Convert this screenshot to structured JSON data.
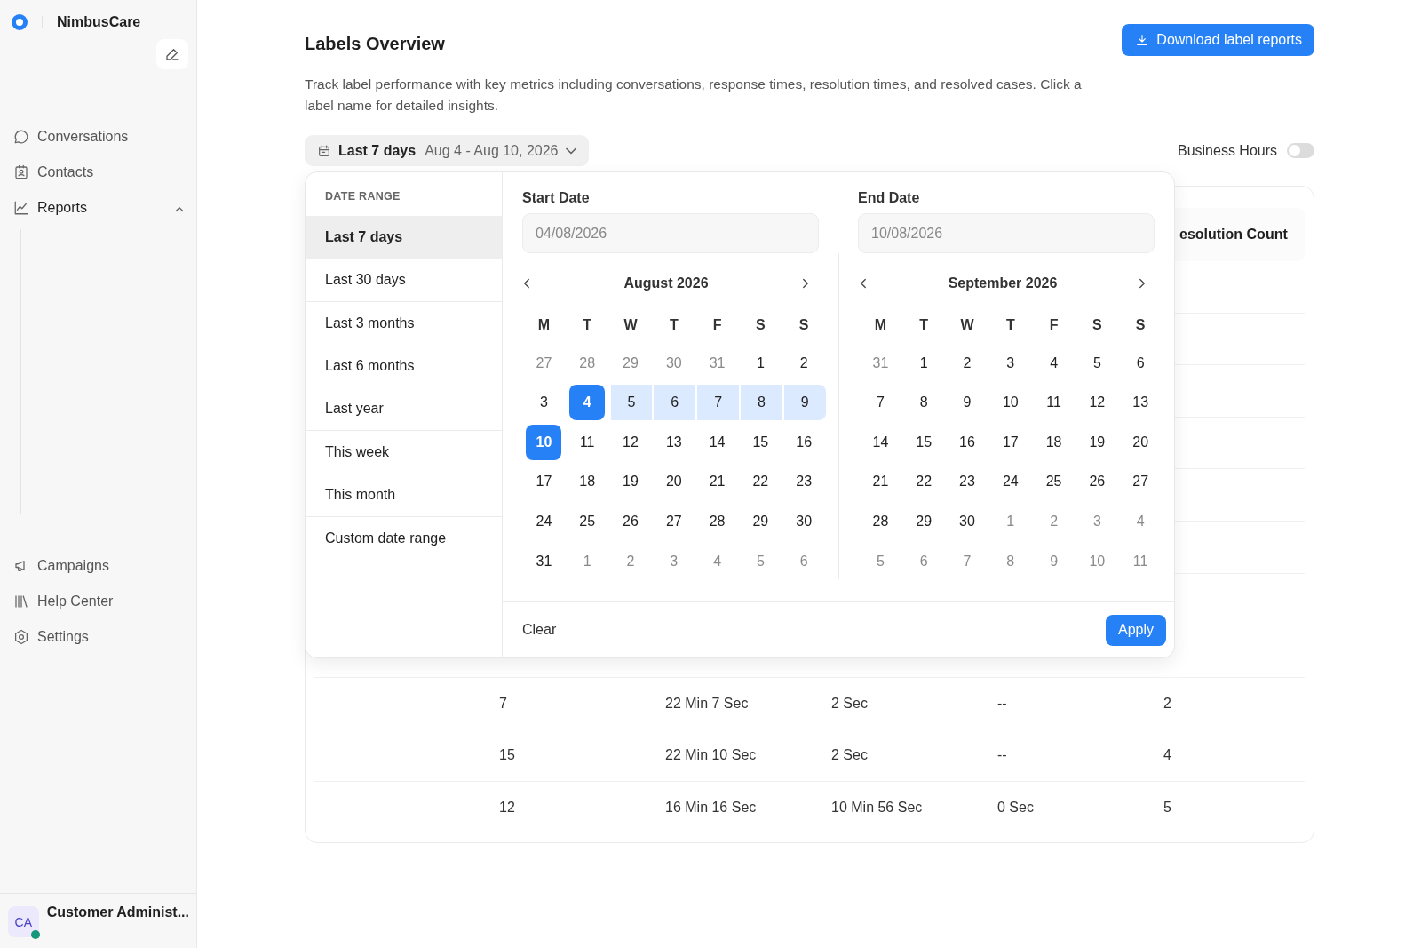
{
  "sidebar": {
    "brand": "NimbusCare",
    "nav": [
      {
        "label": "Conversations"
      },
      {
        "label": "Contacts"
      },
      {
        "label": "Reports",
        "expanded": true
      }
    ],
    "nav_bottom": [
      {
        "label": "Campaigns"
      },
      {
        "label": "Help Center"
      },
      {
        "label": "Settings"
      }
    ],
    "user": {
      "initials": "CA",
      "name": "Customer Administ...",
      "online": true
    }
  },
  "main": {
    "title": "Labels Overview",
    "download_button": "Download label reports",
    "description": "Track label performance with key metrics including conversations, response times, resolution times, and resolved cases. Click a label name for detailed insights.",
    "date_filter": {
      "preset": "Last 7 days",
      "range": "Aug 4 - Aug 10, 2026"
    },
    "business_hours": {
      "label": "Business Hours",
      "on": false
    },
    "table": {
      "visible_header": "esolution Count",
      "rows": [
        [
          "7",
          "22 Min 7 Sec",
          "2 Sec",
          "--",
          "2"
        ],
        [
          "15",
          "22 Min 10 Sec",
          "2 Sec",
          "--",
          "4"
        ],
        [
          "12",
          "16 Min 16 Sec",
          "10 Min 56 Sec",
          "0 Sec",
          "5"
        ]
      ]
    },
    "date_picker": {
      "heading": "DATE RANGE",
      "preset_groups": [
        [
          {
            "label": "Last 7 days",
            "selected": true
          },
          {
            "label": "Last 30 days",
            "selected": false
          }
        ],
        [
          {
            "label": "Last 3 months",
            "selected": false
          },
          {
            "label": "Last 6 months",
            "selected": false
          },
          {
            "label": "Last year",
            "selected": false
          }
        ],
        [
          {
            "label": "This week",
            "selected": false
          },
          {
            "label": "This month",
            "selected": false
          }
        ],
        [
          {
            "label": "Custom date range",
            "selected": false
          }
        ]
      ],
      "fields": [
        {
          "label": "Start Date",
          "placeholder": "04/08/2026"
        },
        {
          "label": "End Date",
          "placeholder": "10/08/2026"
        }
      ],
      "months": [
        {
          "title": "August 2026",
          "weekdays": [
            "M",
            "T",
            "W",
            "T",
            "F",
            "S",
            "S"
          ],
          "weeks": [
            [
              {
                "day": "27",
                "muted": true,
                "selected": false,
                "in_range": false
              },
              {
                "day": "28",
                "muted": true,
                "selected": false,
                "in_range": false
              },
              {
                "day": "29",
                "muted": true,
                "selected": false,
                "in_range": false
              },
              {
                "day": "30",
                "muted": true,
                "selected": false,
                "in_range": false
              },
              {
                "day": "31",
                "muted": true,
                "selected": false,
                "in_range": false
              },
              {
                "day": "1",
                "muted": false,
                "selected": false,
                "in_range": false
              },
              {
                "day": "2",
                "muted": false,
                "selected": false,
                "in_range": false
              }
            ],
            [
              {
                "day": "3",
                "muted": false,
                "selected": false,
                "in_range": false
              },
              {
                "day": "4",
                "muted": false,
                "selected": true,
                "in_range": false
              },
              {
                "day": "5",
                "muted": false,
                "selected": false,
                "in_range": true
              },
              {
                "day": "6",
                "muted": false,
                "selected": false,
                "in_range": true
              },
              {
                "day": "7",
                "muted": false,
                "selected": false,
                "in_range": true
              },
              {
                "day": "8",
                "muted": false,
                "selected": false,
                "in_range": true
              },
              {
                "day": "9",
                "muted": false,
                "selected": false,
                "in_range": true
              }
            ],
            [
              {
                "day": "10",
                "muted": false,
                "selected": true,
                "in_range": false
              },
              {
                "day": "11",
                "muted": false,
                "selected": false,
                "in_range": false
              },
              {
                "day": "12",
                "muted": false,
                "selected": false,
                "in_range": false
              },
              {
                "day": "13",
                "muted": false,
                "selected": false,
                "in_range": false
              },
              {
                "day": "14",
                "muted": false,
                "selected": false,
                "in_range": false
              },
              {
                "day": "15",
                "muted": false,
                "selected": false,
                "in_range": false
              },
              {
                "day": "16",
                "muted": false,
                "selected": false,
                "in_range": false
              }
            ],
            [
              {
                "day": "17",
                "muted": false,
                "selected": false,
                "in_range": false
              },
              {
                "day": "18",
                "muted": false,
                "selected": false,
                "in_range": false
              },
              {
                "day": "19",
                "muted": false,
                "selected": false,
                "in_range": false
              },
              {
                "day": "20",
                "muted": false,
                "selected": false,
                "in_range": false
              },
              {
                "day": "21",
                "muted": false,
                "selected": false,
                "in_range": false
              },
              {
                "day": "22",
                "muted": false,
                "selected": false,
                "in_range": false
              },
              {
                "day": "23",
                "muted": false,
                "selected": false,
                "in_range": false
              }
            ],
            [
              {
                "day": "24",
                "muted": false,
                "selected": false,
                "in_range": false
              },
              {
                "day": "25",
                "muted": false,
                "selected": false,
                "in_range": false
              },
              {
                "day": "26",
                "muted": false,
                "selected": false,
                "in_range": false
              },
              {
                "day": "27",
                "muted": false,
                "selected": false,
                "in_range": false
              },
              {
                "day": "28",
                "muted": false,
                "selected": false,
                "in_range": false
              },
              {
                "day": "29",
                "muted": false,
                "selected": false,
                "in_range": false
              },
              {
                "day": "30",
                "muted": false,
                "selected": false,
                "in_range": false
              }
            ],
            [
              {
                "day": "31",
                "muted": false,
                "selected": false,
                "in_range": false
              },
              {
                "day": "1",
                "muted": true,
                "selected": false,
                "in_range": false
              },
              {
                "day": "2",
                "muted": true,
                "selected": false,
                "in_range": false
              },
              {
                "day": "3",
                "muted": true,
                "selected": false,
                "in_range": false
              },
              {
                "day": "4",
                "muted": true,
                "selected": false,
                "in_range": false
              },
              {
                "day": "5",
                "muted": true,
                "selected": false,
                "in_range": false
              },
              {
                "day": "6",
                "muted": true,
                "selected": false,
                "in_range": false
              }
            ]
          ]
        },
        {
          "title": "September 2026",
          "weekdays": [
            "M",
            "T",
            "W",
            "T",
            "F",
            "S",
            "S"
          ],
          "weeks": [
            [
              {
                "day": "31",
                "muted": true,
                "selected": false,
                "in_range": false
              },
              {
                "day": "1",
                "muted": false,
                "selected": false,
                "in_range": false
              },
              {
                "day": "2",
                "muted": false,
                "selected": false,
                "in_range": false
              },
              {
                "day": "3",
                "muted": false,
                "selected": false,
                "in_range": false
              },
              {
                "day": "4",
                "muted": false,
                "selected": false,
                "in_range": false
              },
              {
                "day": "5",
                "muted": false,
                "selected": false,
                "in_range": false
              },
              {
                "day": "6",
                "muted": false,
                "selected": false,
                "in_range": false
              }
            ],
            [
              {
                "day": "7",
                "muted": false,
                "selected": false,
                "in_range": false
              },
              {
                "day": "8",
                "muted": false,
                "selected": false,
                "in_range": false
              },
              {
                "day": "9",
                "muted": false,
                "selected": false,
                "in_range": false
              },
              {
                "day": "10",
                "muted": false,
                "selected": false,
                "in_range": false
              },
              {
                "day": "11",
                "muted": false,
                "selected": false,
                "in_range": false
              },
              {
                "day": "12",
                "muted": false,
                "selected": false,
                "in_range": false
              },
              {
                "day": "13",
                "muted": false,
                "selected": false,
                "in_range": false
              }
            ],
            [
              {
                "day": "14",
                "muted": false,
                "selected": false,
                "in_range": false
              },
              {
                "day": "15",
                "muted": false,
                "selected": false,
                "in_range": false
              },
              {
                "day": "16",
                "muted": false,
                "selected": false,
                "in_range": false
              },
              {
                "day": "17",
                "muted": false,
                "selected": false,
                "in_range": false
              },
              {
                "day": "18",
                "muted": false,
                "selected": false,
                "in_range": false
              },
              {
                "day": "19",
                "muted": false,
                "selected": false,
                "in_range": false
              },
              {
                "day": "20",
                "muted": false,
                "selected": false,
                "in_range": false
              }
            ],
            [
              {
                "day": "21",
                "muted": false,
                "selected": false,
                "in_range": false
              },
              {
                "day": "22",
                "muted": false,
                "selected": false,
                "in_range": false
              },
              {
                "day": "23",
                "muted": false,
                "selected": false,
                "in_range": false
              },
              {
                "day": "24",
                "muted": false,
                "selected": false,
                "in_range": false
              },
              {
                "day": "25",
                "muted": false,
                "selected": false,
                "in_range": false
              },
              {
                "day": "26",
                "muted": false,
                "selected": false,
                "in_range": false
              },
              {
                "day": "27",
                "muted": false,
                "selected": false,
                "in_range": false
              }
            ],
            [
              {
                "day": "28",
                "muted": false,
                "selected": false,
                "in_range": false
              },
              {
                "day": "29",
                "muted": false,
                "selected": false,
                "in_range": false
              },
              {
                "day": "30",
                "muted": false,
                "selected": false,
                "in_range": false
              },
              {
                "day": "1",
                "muted": true,
                "selected": false,
                "in_range": false
              },
              {
                "day": "2",
                "muted": true,
                "selected": false,
                "in_range": false
              },
              {
                "day": "3",
                "muted": true,
                "selected": false,
                "in_range": false
              },
              {
                "day": "4",
                "muted": true,
                "selected": false,
                "in_range": false
              }
            ],
            [
              {
                "day": "5",
                "muted": true,
                "selected": false,
                "in_range": false
              },
              {
                "day": "6",
                "muted": true,
                "selected": false,
                "in_range": false
              },
              {
                "day": "7",
                "muted": true,
                "selected": false,
                "in_range": false
              },
              {
                "day": "8",
                "muted": true,
                "selected": false,
                "in_range": false
              },
              {
                "day": "9",
                "muted": true,
                "selected": false,
                "in_range": false
              },
              {
                "day": "10",
                "muted": true,
                "selected": false,
                "in_range": false
              },
              {
                "day": "11",
                "muted": true,
                "selected": false,
                "in_range": false
              }
            ]
          ]
        }
      ],
      "clear_button": "Clear",
      "apply_button": "Apply"
    }
  }
}
